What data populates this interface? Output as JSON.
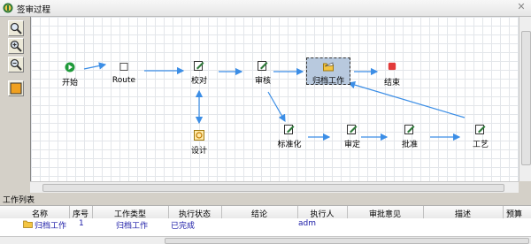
{
  "window": {
    "title": "签审过程"
  },
  "toolbar": {
    "zoom_fit": "zoom-fit-icon",
    "zoom_in": "zoom-in-icon",
    "zoom_out": "zoom-out-icon",
    "color_box": "color-box-icon"
  },
  "nodes": {
    "start": "开始",
    "route": "Route",
    "proofread": "校对",
    "review": "审核",
    "archive": "归档工作",
    "end": "结束",
    "design": "设计",
    "standardize": "标准化",
    "approve_check": "审定",
    "approve": "批准",
    "process": "工艺"
  },
  "colors": {
    "arrow": "#3c8ee6",
    "selected_fill": "#b8c9de",
    "row_text": "#1a1aa6"
  },
  "worklist": {
    "title": "工作列表",
    "columns": [
      "名称",
      "序号",
      "工作类型",
      "执行状态",
      "结论",
      "执行人",
      "审批意见",
      "描述",
      "预算"
    ],
    "rows": [
      {
        "name": "归档工作",
        "index": "1",
        "type": "归档工作",
        "status": "已完成",
        "conclusion": "",
        "executor": "adm",
        "opinion": "",
        "desc": "",
        "budget": ""
      }
    ]
  }
}
